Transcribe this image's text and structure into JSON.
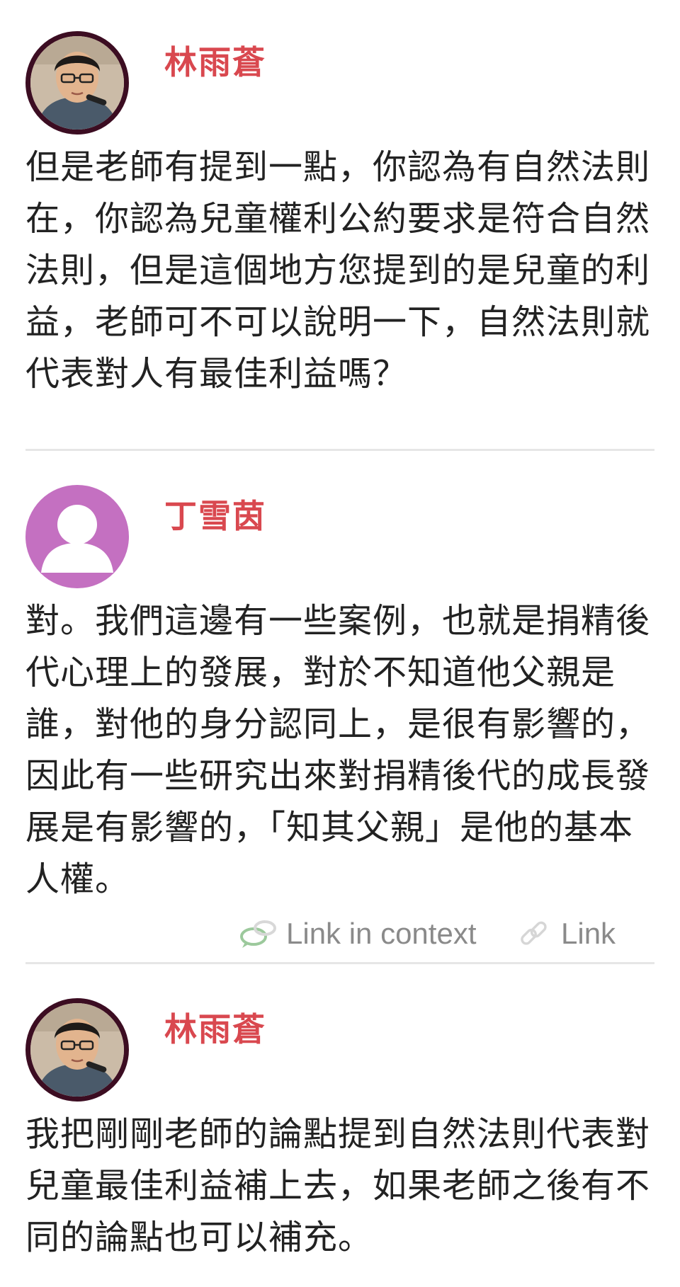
{
  "posts": [
    {
      "speaker": "林雨蒼",
      "avatar": "photo-avatar",
      "text": "但是老師有提到一點，你認為有自然法則在，你認為兒童權利公約要求是符合自然法則，但是這個地方您提到的是兒童的利益，老師可不可以說明一下，自然法則就代表對人有最佳利益嗎？"
    },
    {
      "speaker": "丁雪茵",
      "avatar": "default-user-icon",
      "text": "對。我們這邊有一些案例，也就是捐精後代心理上的發展，對於不知道他父親是誰，對他的身分認同上，是很有影響的，因此有一些研究出來對捐精後代的成長發展是有影響的，「知其父親」是他的基本人權。",
      "actions": {
        "link_in_context_label": "Link in context",
        "link_label": "Link",
        "link_in_context_icon": "speech-bubble-icon",
        "link_icon": "chain-link-icon"
      }
    },
    {
      "speaker": "林雨蒼",
      "avatar": "photo-avatar",
      "text": "我把剛剛老師的論點提到自然法則代表對兒童最佳利益補上去，如果老師之後有不同的論點也可以補充。"
    }
  ],
  "colors": {
    "speaker_name": "#d9484f",
    "avatar_ring": "#3c0d22",
    "default_avatar": "#c470c1",
    "link_text": "#8a8a8a",
    "link_in_context_icon": "#9cc99c",
    "divider": "#e6e6e6"
  }
}
